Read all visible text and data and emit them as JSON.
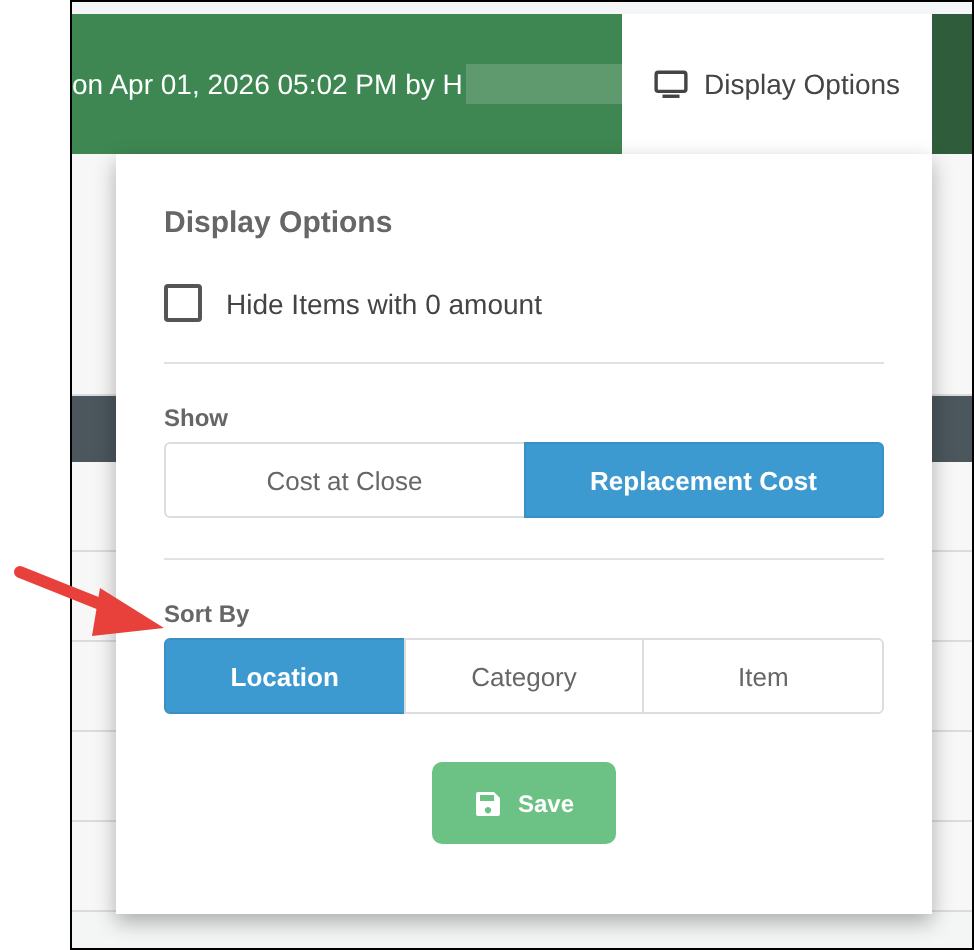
{
  "header": {
    "text": "on Apr 01, 2026 05:02 PM by H",
    "tab": {
      "label": "Display Options"
    }
  },
  "popup": {
    "title": "Display Options",
    "checkbox": {
      "label": "Hide Items with 0 amount",
      "checked": false
    },
    "sections": [
      {
        "label": "Show",
        "options": [
          {
            "label": "Cost at Close",
            "selected": false
          },
          {
            "label": "Replacement Cost",
            "selected": true
          }
        ]
      },
      {
        "label": "Sort By",
        "options": [
          {
            "label": "Location",
            "selected": true
          },
          {
            "label": "Category",
            "selected": false
          },
          {
            "label": "Item",
            "selected": false
          }
        ]
      }
    ],
    "save_button": {
      "label": "Save"
    }
  }
}
